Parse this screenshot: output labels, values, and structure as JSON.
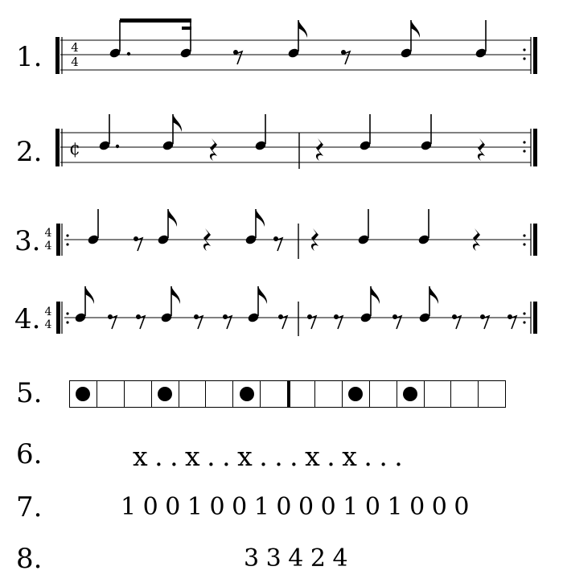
{
  "rows": [
    {
      "label": "1.",
      "time_signature": "4/4"
    },
    {
      "label": "2.",
      "time_signature": "¢"
    },
    {
      "label": "3.",
      "time_signature": "4/4"
    },
    {
      "label": "4.",
      "time_signature": "4/4"
    },
    {
      "label": "5."
    },
    {
      "label": "6.",
      "text": "x . . x . . x . . . x . x . . ."
    },
    {
      "label": "7.",
      "text": "1 0 0 1 0 0 1 0 0 0 1 0 1 0 0 0"
    },
    {
      "label": "8.",
      "text": "3 3 4 2 4"
    }
  ],
  "box_notation": {
    "cells": [
      1,
      0,
      0,
      1,
      0,
      0,
      1,
      0,
      0,
      0,
      1,
      0,
      1,
      0,
      0,
      0
    ],
    "bar_after_cell": 8
  },
  "colors": {
    "ink": "#000000",
    "background": "#ffffff"
  }
}
